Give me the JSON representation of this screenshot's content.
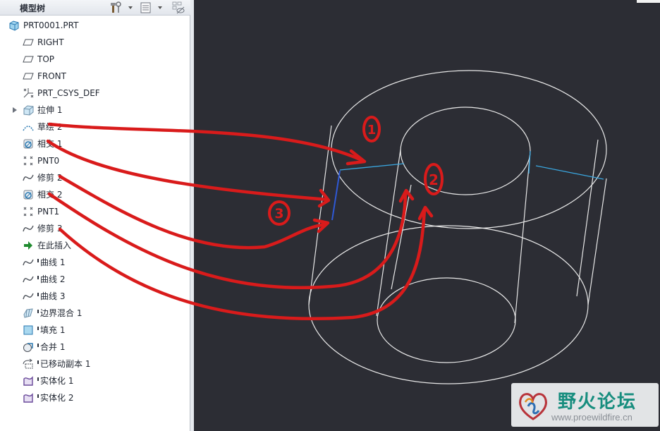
{
  "tree": {
    "title": "模型树",
    "items": [
      {
        "label": "PRT0001.PRT",
        "icon": "part-icon"
      },
      {
        "label": "RIGHT",
        "icon": "datum-plane-icon"
      },
      {
        "label": "TOP",
        "icon": "datum-plane-icon"
      },
      {
        "label": "FRONT",
        "icon": "datum-plane-icon"
      },
      {
        "label": "PRT_CSYS_DEF",
        "icon": "csys-icon"
      },
      {
        "label": "拉伸 1",
        "icon": "extrude-icon",
        "expandable": true
      },
      {
        "label": "草绘 2",
        "icon": "sketch-icon"
      },
      {
        "label": "相交 1",
        "icon": "intersect-icon"
      },
      {
        "label": "PNT0",
        "icon": "datum-point-icon"
      },
      {
        "label": "修剪 2",
        "icon": "curve-icon"
      },
      {
        "label": "相交 2",
        "icon": "intersect-icon"
      },
      {
        "label": "PNT1",
        "icon": "datum-point-icon"
      },
      {
        "label": "修剪 3",
        "icon": "curve-icon"
      },
      {
        "label": "在此插入",
        "icon": "insert-here-arrow-icon"
      },
      {
        "label": "曲线 1",
        "icon": "curve-icon",
        "suppressed": true
      },
      {
        "label": "曲线 2",
        "icon": "curve-icon",
        "suppressed": true
      },
      {
        "label": "曲线 3",
        "icon": "curve-icon",
        "suppressed": true
      },
      {
        "label": "边界混合 1",
        "icon": "boundary-blend-icon",
        "suppressed": true
      },
      {
        "label": "填充 1",
        "icon": "fill-icon",
        "suppressed": true
      },
      {
        "label": "合并 1",
        "icon": "merge-icon",
        "suppressed": true
      },
      {
        "label": "已移动副本 1",
        "icon": "moved-copy-icon",
        "suppressed": true
      },
      {
        "label": "实体化 1",
        "icon": "solidify-icon",
        "suppressed": true
      },
      {
        "label": "实体化 2",
        "icon": "solidify-icon",
        "suppressed": true
      }
    ]
  },
  "header_icons": [
    "settings-tools-icon",
    "tree-columns-icon",
    "show-hide-icon"
  ],
  "annotations": {
    "mark1": "1",
    "mark2": "2",
    "mark3": "3"
  },
  "watermark": {
    "title": "野火论坛",
    "url": "www.proewildfire.cn"
  },
  "colors": {
    "annotation": "#d91b1b",
    "edge": "#e8e8e8",
    "highlight": "#3aa7e0",
    "background": "#2c2d34",
    "watermark": "#178d7e"
  }
}
